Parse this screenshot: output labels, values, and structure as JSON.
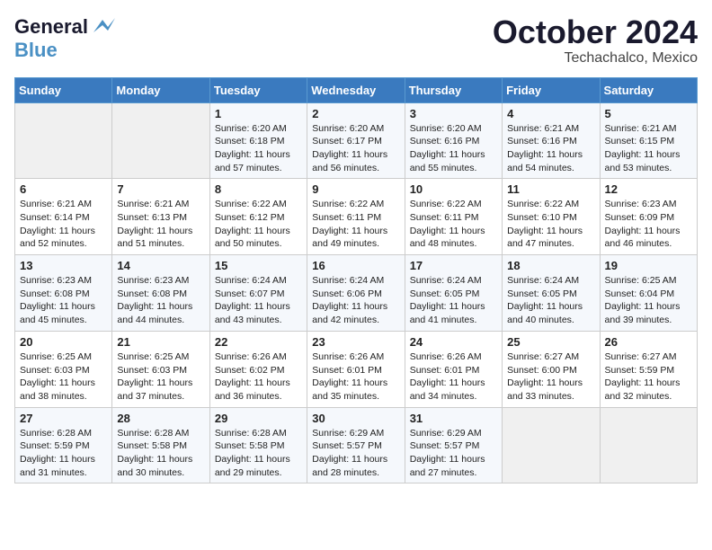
{
  "header": {
    "logo_line1": "General",
    "logo_line2": "Blue",
    "month": "October 2024",
    "location": "Techachalco, Mexico"
  },
  "weekdays": [
    "Sunday",
    "Monday",
    "Tuesday",
    "Wednesday",
    "Thursday",
    "Friday",
    "Saturday"
  ],
  "weeks": [
    [
      {
        "day": "",
        "info": ""
      },
      {
        "day": "",
        "info": ""
      },
      {
        "day": "1",
        "info": "Sunrise: 6:20 AM\nSunset: 6:18 PM\nDaylight: 11 hours and 57 minutes."
      },
      {
        "day": "2",
        "info": "Sunrise: 6:20 AM\nSunset: 6:17 PM\nDaylight: 11 hours and 56 minutes."
      },
      {
        "day": "3",
        "info": "Sunrise: 6:20 AM\nSunset: 6:16 PM\nDaylight: 11 hours and 55 minutes."
      },
      {
        "day": "4",
        "info": "Sunrise: 6:21 AM\nSunset: 6:16 PM\nDaylight: 11 hours and 54 minutes."
      },
      {
        "day": "5",
        "info": "Sunrise: 6:21 AM\nSunset: 6:15 PM\nDaylight: 11 hours and 53 minutes."
      }
    ],
    [
      {
        "day": "6",
        "info": "Sunrise: 6:21 AM\nSunset: 6:14 PM\nDaylight: 11 hours and 52 minutes."
      },
      {
        "day": "7",
        "info": "Sunrise: 6:21 AM\nSunset: 6:13 PM\nDaylight: 11 hours and 51 minutes."
      },
      {
        "day": "8",
        "info": "Sunrise: 6:22 AM\nSunset: 6:12 PM\nDaylight: 11 hours and 50 minutes."
      },
      {
        "day": "9",
        "info": "Sunrise: 6:22 AM\nSunset: 6:11 PM\nDaylight: 11 hours and 49 minutes."
      },
      {
        "day": "10",
        "info": "Sunrise: 6:22 AM\nSunset: 6:11 PM\nDaylight: 11 hours and 48 minutes."
      },
      {
        "day": "11",
        "info": "Sunrise: 6:22 AM\nSunset: 6:10 PM\nDaylight: 11 hours and 47 minutes."
      },
      {
        "day": "12",
        "info": "Sunrise: 6:23 AM\nSunset: 6:09 PM\nDaylight: 11 hours and 46 minutes."
      }
    ],
    [
      {
        "day": "13",
        "info": "Sunrise: 6:23 AM\nSunset: 6:08 PM\nDaylight: 11 hours and 45 minutes."
      },
      {
        "day": "14",
        "info": "Sunrise: 6:23 AM\nSunset: 6:08 PM\nDaylight: 11 hours and 44 minutes."
      },
      {
        "day": "15",
        "info": "Sunrise: 6:24 AM\nSunset: 6:07 PM\nDaylight: 11 hours and 43 minutes."
      },
      {
        "day": "16",
        "info": "Sunrise: 6:24 AM\nSunset: 6:06 PM\nDaylight: 11 hours and 42 minutes."
      },
      {
        "day": "17",
        "info": "Sunrise: 6:24 AM\nSunset: 6:05 PM\nDaylight: 11 hours and 41 minutes."
      },
      {
        "day": "18",
        "info": "Sunrise: 6:24 AM\nSunset: 6:05 PM\nDaylight: 11 hours and 40 minutes."
      },
      {
        "day": "19",
        "info": "Sunrise: 6:25 AM\nSunset: 6:04 PM\nDaylight: 11 hours and 39 minutes."
      }
    ],
    [
      {
        "day": "20",
        "info": "Sunrise: 6:25 AM\nSunset: 6:03 PM\nDaylight: 11 hours and 38 minutes."
      },
      {
        "day": "21",
        "info": "Sunrise: 6:25 AM\nSunset: 6:03 PM\nDaylight: 11 hours and 37 minutes."
      },
      {
        "day": "22",
        "info": "Sunrise: 6:26 AM\nSunset: 6:02 PM\nDaylight: 11 hours and 36 minutes."
      },
      {
        "day": "23",
        "info": "Sunrise: 6:26 AM\nSunset: 6:01 PM\nDaylight: 11 hours and 35 minutes."
      },
      {
        "day": "24",
        "info": "Sunrise: 6:26 AM\nSunset: 6:01 PM\nDaylight: 11 hours and 34 minutes."
      },
      {
        "day": "25",
        "info": "Sunrise: 6:27 AM\nSunset: 6:00 PM\nDaylight: 11 hours and 33 minutes."
      },
      {
        "day": "26",
        "info": "Sunrise: 6:27 AM\nSunset: 5:59 PM\nDaylight: 11 hours and 32 minutes."
      }
    ],
    [
      {
        "day": "27",
        "info": "Sunrise: 6:28 AM\nSunset: 5:59 PM\nDaylight: 11 hours and 31 minutes."
      },
      {
        "day": "28",
        "info": "Sunrise: 6:28 AM\nSunset: 5:58 PM\nDaylight: 11 hours and 30 minutes."
      },
      {
        "day": "29",
        "info": "Sunrise: 6:28 AM\nSunset: 5:58 PM\nDaylight: 11 hours and 29 minutes."
      },
      {
        "day": "30",
        "info": "Sunrise: 6:29 AM\nSunset: 5:57 PM\nDaylight: 11 hours and 28 minutes."
      },
      {
        "day": "31",
        "info": "Sunrise: 6:29 AM\nSunset: 5:57 PM\nDaylight: 11 hours and 27 minutes."
      },
      {
        "day": "",
        "info": ""
      },
      {
        "day": "",
        "info": ""
      }
    ]
  ]
}
